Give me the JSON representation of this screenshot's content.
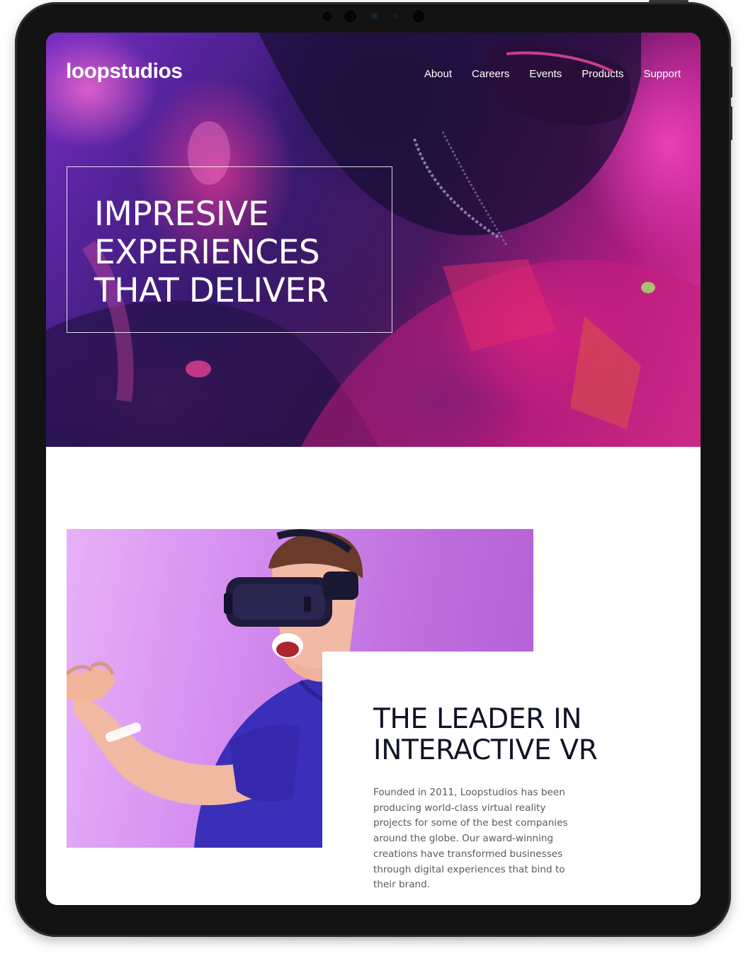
{
  "header": {
    "logo": "loopstudios",
    "nav": [
      {
        "label": "About"
      },
      {
        "label": "Careers"
      },
      {
        "label": "Events"
      },
      {
        "label": "Products"
      },
      {
        "label": "Support"
      }
    ]
  },
  "hero": {
    "headline": "IMPRESIVE\nEXPERIENCES\nTHAT DELIVER"
  },
  "leader": {
    "title": "THE LEADER IN\nINTERACTIVE VR",
    "text": "Founded in 2011, Loopstudios has been producing world-class virtual reality projects for some of the best companies around the globe. Our award-winning creations have transformed businesses through digital experiences that bind to their brand."
  },
  "colors": {
    "device_frame": "#131313",
    "hero_accent": "#ff3fb0",
    "hero_purple": "#3b1c7a",
    "image_violet": "#c87be8",
    "shirt_blue": "#3a2fb8",
    "heading_dark": "#101326"
  },
  "icons": {
    "camera": "camera-lens-icon"
  }
}
